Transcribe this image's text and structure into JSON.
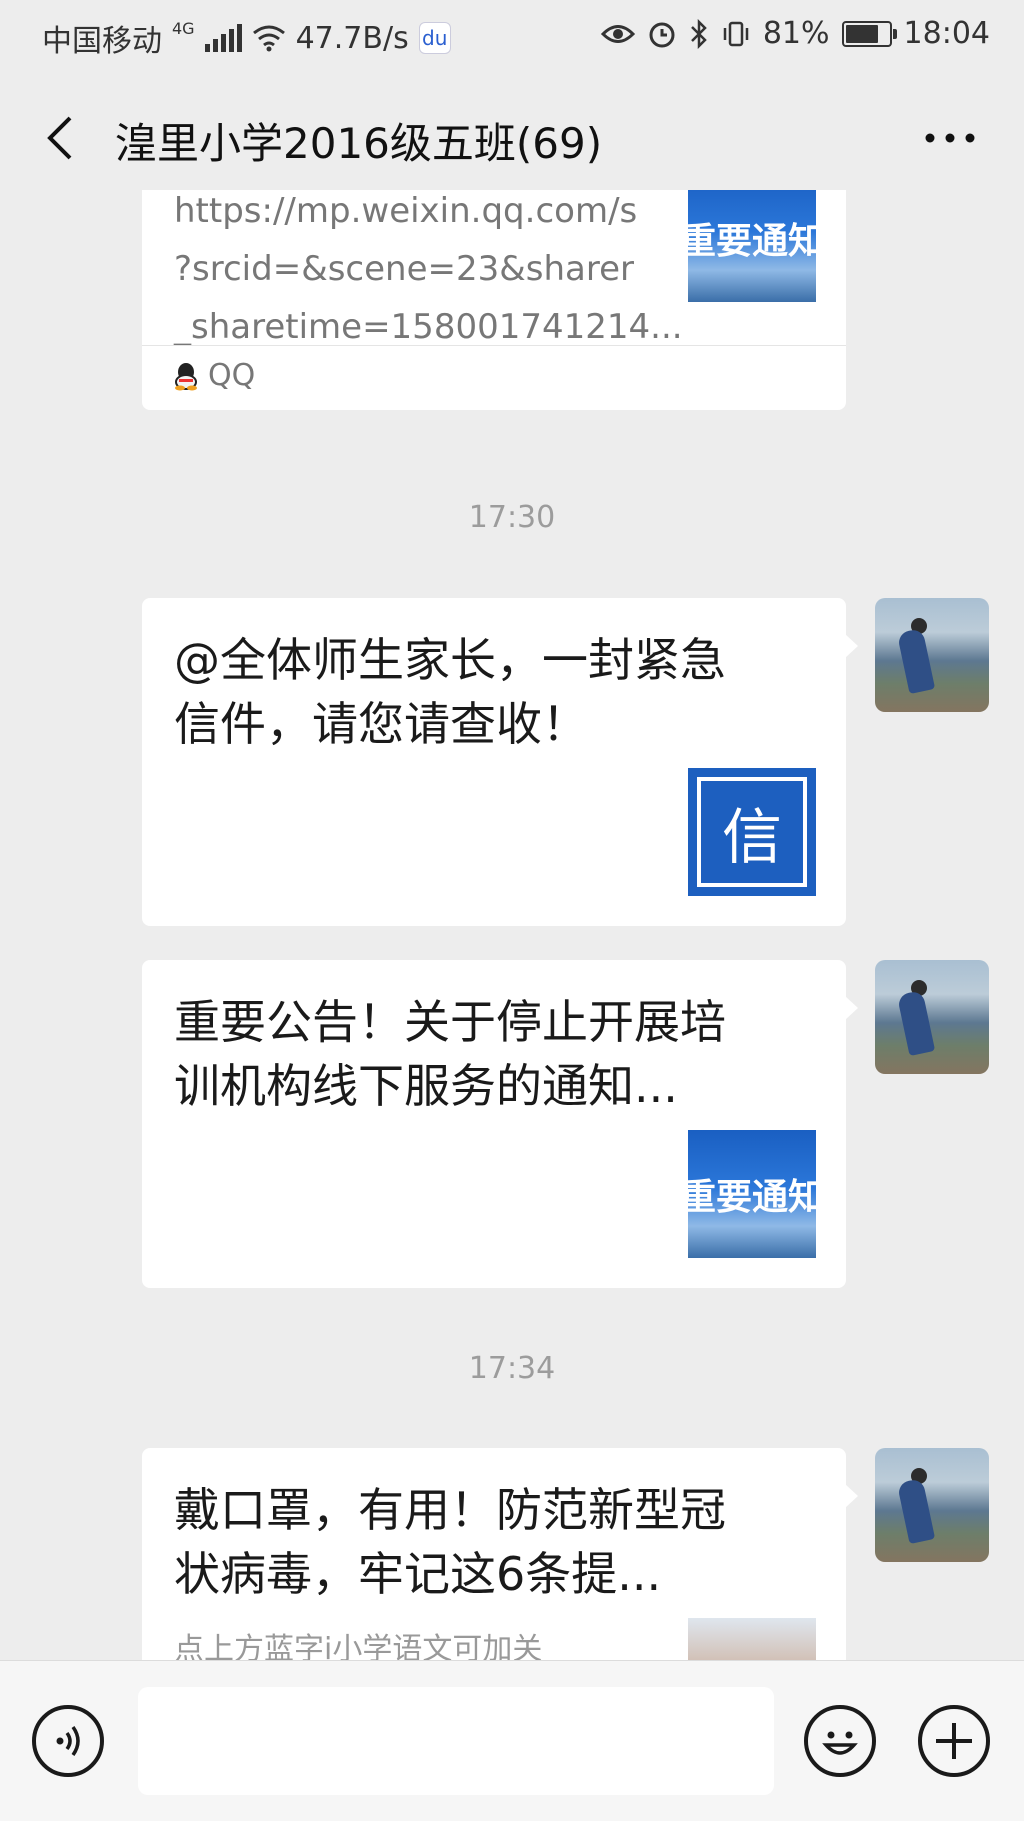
{
  "status_bar": {
    "carrier": "中国移动",
    "network_type": "4G",
    "speed": "47.7B/s",
    "battery": "81%",
    "battery_level": 0.81,
    "time": "18:04",
    "icons": [
      "signal-icon",
      "wifi-icon",
      "baidu-icon",
      "eye-icon",
      "alarm-icon",
      "bluetooth-icon",
      "vibrate-icon",
      "battery-icon"
    ]
  },
  "header": {
    "title": "湟里小学2016级五班(69)",
    "back_icon": "chevron-left-icon",
    "more_icon": "more-dots-icon"
  },
  "chat": {
    "shared_link": {
      "url_lines": [
        "https://mp.weixin.qq.com/s",
        "?srcid=&scene=23&sharer",
        "_sharetime=158001741214..."
      ],
      "thumb_text": "重要通知",
      "source": "QQ"
    },
    "time_1": "17:30",
    "message_1": {
      "title": "@全体师生家长，一封紧急信件，请您请查收！",
      "thumb_text": "信"
    },
    "message_2": {
      "title": "重要公告！关于停止开展培训机构线下服务的通知...",
      "thumb_text": "重要通知"
    },
    "time_2": "17:34",
    "message_3": {
      "title": "戴口罩，有用！防范新型冠状病毒，牢记这6条提...",
      "desc": "点上方蓝字i小学语文可加关"
    }
  },
  "input_bar": {
    "value": "",
    "icons": [
      "voice-icon",
      "emoji-icon",
      "plus-icon"
    ]
  }
}
